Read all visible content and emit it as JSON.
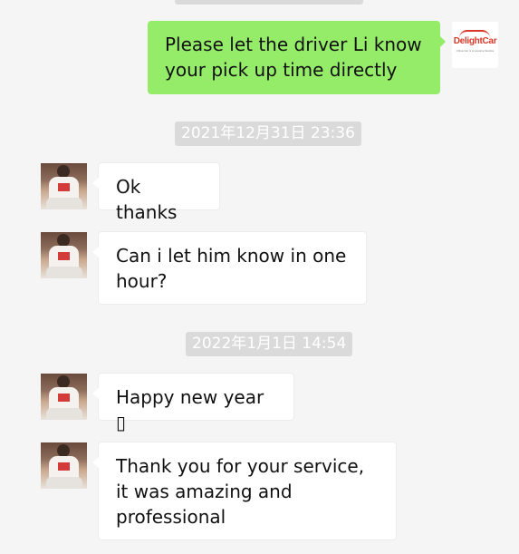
{
  "messages": {
    "m1": {
      "text": "Please let the driver Li know your pick up time directly"
    },
    "ts1": "2021年12月31日 23:36",
    "m2": {
      "text": "Ok thanks"
    },
    "m3": {
      "text": "Can i let him know in one hour?"
    },
    "ts2": "2022年1月1日 14:54",
    "m4": {
      "text": "Happy new year ▯"
    },
    "m5": {
      "text": "Thank you for your service, it was amazing and professional"
    }
  },
  "sender_logo": {
    "brand": "DelightCar",
    "tagline": "China Car & Limousine Service",
    "brand_color": "#d8392a"
  },
  "colors": {
    "background": "#f5f5f5",
    "outgoing_bubble": "#95ec69",
    "incoming_bubble": "#ffffff",
    "timestamp_bg": "#dadada"
  },
  "icons": {
    "contact_avatar": "person-photo-avatar",
    "own_avatar": "delightcar-logo"
  }
}
